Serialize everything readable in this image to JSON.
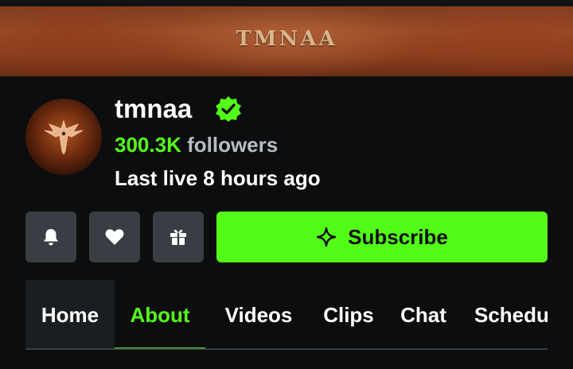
{
  "banner": {
    "logo_text": "TMNAA"
  },
  "channel": {
    "name": "tmnaa",
    "verified_icon": "verified-badge-icon",
    "followers_count": "300.3K",
    "followers_word": "followers",
    "last_live": "Last live 8 hours ago"
  },
  "actions": {
    "notify_icon": "bell-icon",
    "follow_icon": "heart-icon",
    "gift_icon": "gift-icon",
    "subscribe_label": "Subscribe",
    "subscribe_icon": "sparkle-icon"
  },
  "tabs": [
    {
      "label": "Home"
    },
    {
      "label": "About",
      "active": true
    },
    {
      "label": "Videos"
    },
    {
      "label": "Clips"
    },
    {
      "label": "Chat"
    },
    {
      "label": "Schedu"
    }
  ],
  "colors": {
    "accent": "#53fc18",
    "background": "#0b0d0f",
    "button_gray": "#3a3e44",
    "muted_text": "#b9bcc2"
  }
}
